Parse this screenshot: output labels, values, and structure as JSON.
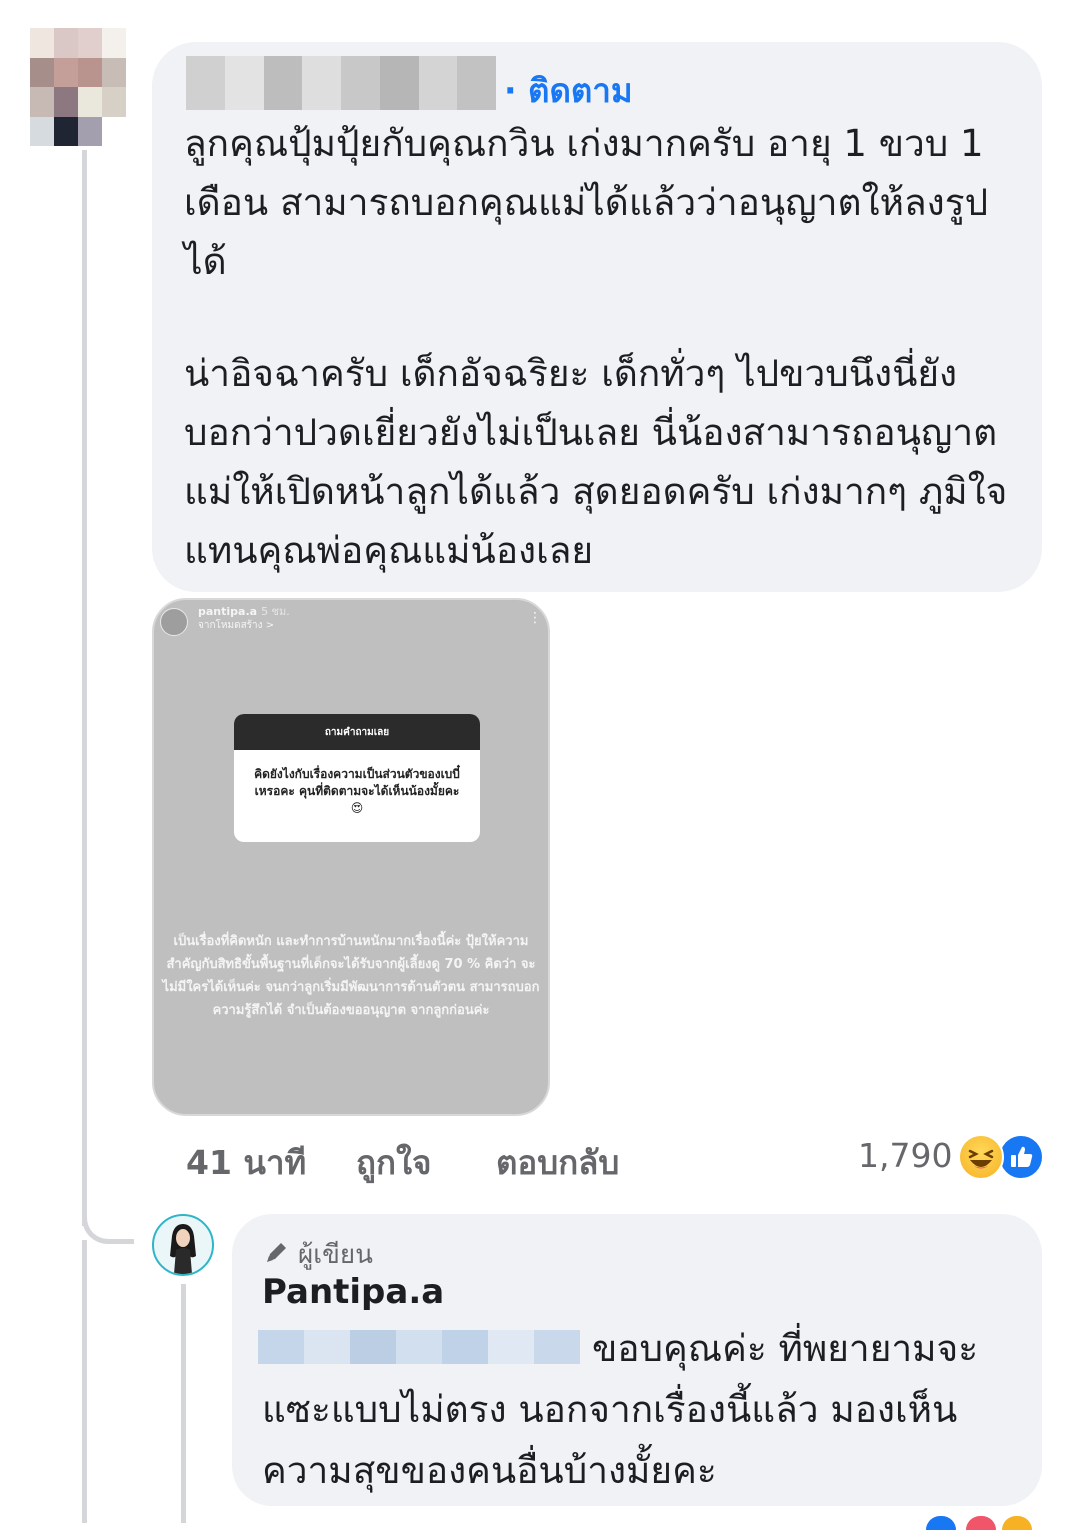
{
  "comment": {
    "follow_label": "· ติดตาม",
    "text_p1": "ลูกคุณปุ้มปุ้ยกับคุณกวิน เก่งมากครับ อายุ 1 ขวบ 1 เดือน สามารถบอกคุณแม่ได้แล้วว่าอนุญาตให้ลงรูปได้",
    "text_p2": "น่าอิจฉาครับ เด็กอัจฉริยะ เด็กทั่วๆ ไปขวบนึงนี่ยังบอกว่าปวดเยี่ยวยังไม่เป็นเลย นี่น้องสามารถอนุญาตแม่ให้เปิดหน้าลูกได้แล้ว สุดยอดครับ เก่งมากๆ ภูมิใจแทนคุณพ่อคุณแม่น้องเลย",
    "story": {
      "username": "pantipa.a",
      "time": "5 ชม.",
      "subtitle": "จากโหมดสร้าง >",
      "question_header": "ถามคำถามเลย",
      "question": "คิดยังไงกับเรื่องความเป็นส่วนตัวของเบบี๋เหรอคะ คุนที่ติดตามจะได้เห็นน้องมั้ยคะ😍",
      "answer": "เป็นเรื่องที่คิดหนัก และทำการบ้านหนักมากเรื่องนี้ค่ะ ปุ้ยให้ความสำคัญกับสิทธิขั้นพื้นฐานที่เด็กจะได้รับจากผู้เลี้ยงดู 70 % คิดว่า จะไม่มีใครได้เห็นค่ะ จนกว่าลูกเริ่มมีพัฒนาการด้านตัวตน สามารถบอกความรู้สึกได้ จำเป็นต้องขออนุญาต จากลูกก่อนค่ะ"
    },
    "actions": {
      "time": "41 นาที",
      "like": "ถูกใจ",
      "reply": "ตอบกลับ"
    },
    "reaction_count": "1,790",
    "reaction_icons": [
      "haha-icon",
      "like-icon"
    ]
  },
  "reply": {
    "badge": "ผู้เขียน",
    "name": "Pantipa.a",
    "text": "ขอบคุณค่ะ ที่พยายามจะแซะแบบไม่ตรง นอกจากเรื่องนี้แล้ว มองเห็นความสุขของคนอื่นบ้างมั้ยคะ"
  },
  "colors": {
    "accent": "#1877f2",
    "bubble": "#f0f2f5",
    "muted_text": "#65676b"
  }
}
